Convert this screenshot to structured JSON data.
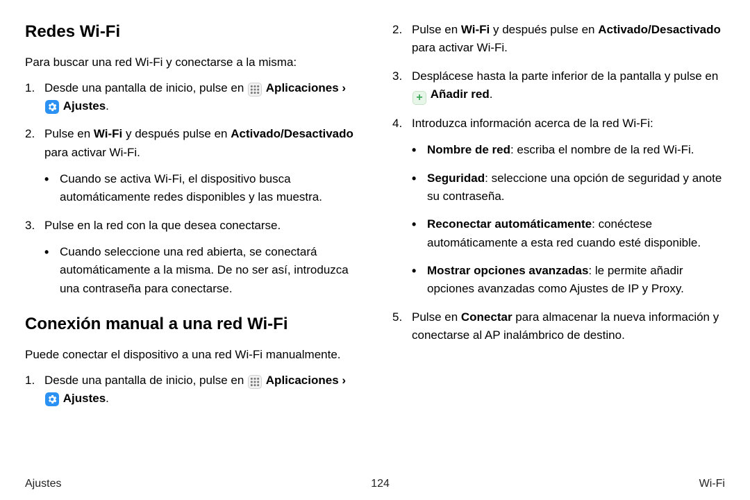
{
  "left": {
    "h1": "Redes Wi-Fi",
    "intro": "Para buscar una red Wi-Fi y conectarse a la misma:",
    "s1_a": "Desde una pantalla de inicio, pulse en ",
    "apps": "Aplicaciones",
    "ajustes": "Ajustes",
    "s2_a": "Pulse en ",
    "wifi": "Wi-Fi",
    "s2_b": " y después pulse en ",
    "onoff": "Activado/Desactivado",
    "s2_c": " para activar Wi-Fi.",
    "s2_bul": "Cuando se activa Wi-Fi, el dispositivo busca automáticamente redes disponibles y las muestra.",
    "s3": "Pulse en la red con la que desea conectarse.",
    "s3_bul": "Cuando seleccione una red abierta, se conectará automáticamente a la misma. De no ser así, introduzca una contraseña para conectarse.",
    "h2": "Conexión manual a una red Wi-Fi",
    "intro2": "Puede conectar el dispositivo a una red Wi-Fi manualmente.",
    "m1_a": "Desde una pantalla de inicio, pulse en "
  },
  "right": {
    "r2_a": "Pulse en ",
    "wifi": "Wi-Fi",
    "r2_b": " y después pulse en ",
    "onoff": "Activado/Desactivado",
    "r2_c": " para activar Wi-Fi.",
    "r3_a": "Desplácese hasta la parte inferior de la pantalla y pulse en ",
    "addnet": "Añadir red",
    "r4": "Introduzca información acerca de la red Wi-Fi:",
    "b1_t": "Nombre de red",
    "b1_r": ": escriba el nombre de la red Wi-Fi.",
    "b2_t": "Seguridad",
    "b2_r": ": seleccione una opción de seguridad y anote su contraseña.",
    "b3_t": "Reconectar automáticamente",
    "b3_r": ": conéctese automáticamente a esta red cuando esté disponible.",
    "b4_t": "Mostrar opciones avanzadas",
    "b4_r": ": le permite añadir opciones avanzadas como Ajustes de IP y Proxy.",
    "r5_a": "Pulse en ",
    "conectar": "Conectar",
    "r5_b": " para almacenar la nueva información y conectarse al AP inalámbrico de destino."
  },
  "footer": {
    "left": "Ajustes",
    "center": "124",
    "right": "Wi-Fi"
  },
  "glyph": {
    "chev": "›",
    "period": "."
  }
}
